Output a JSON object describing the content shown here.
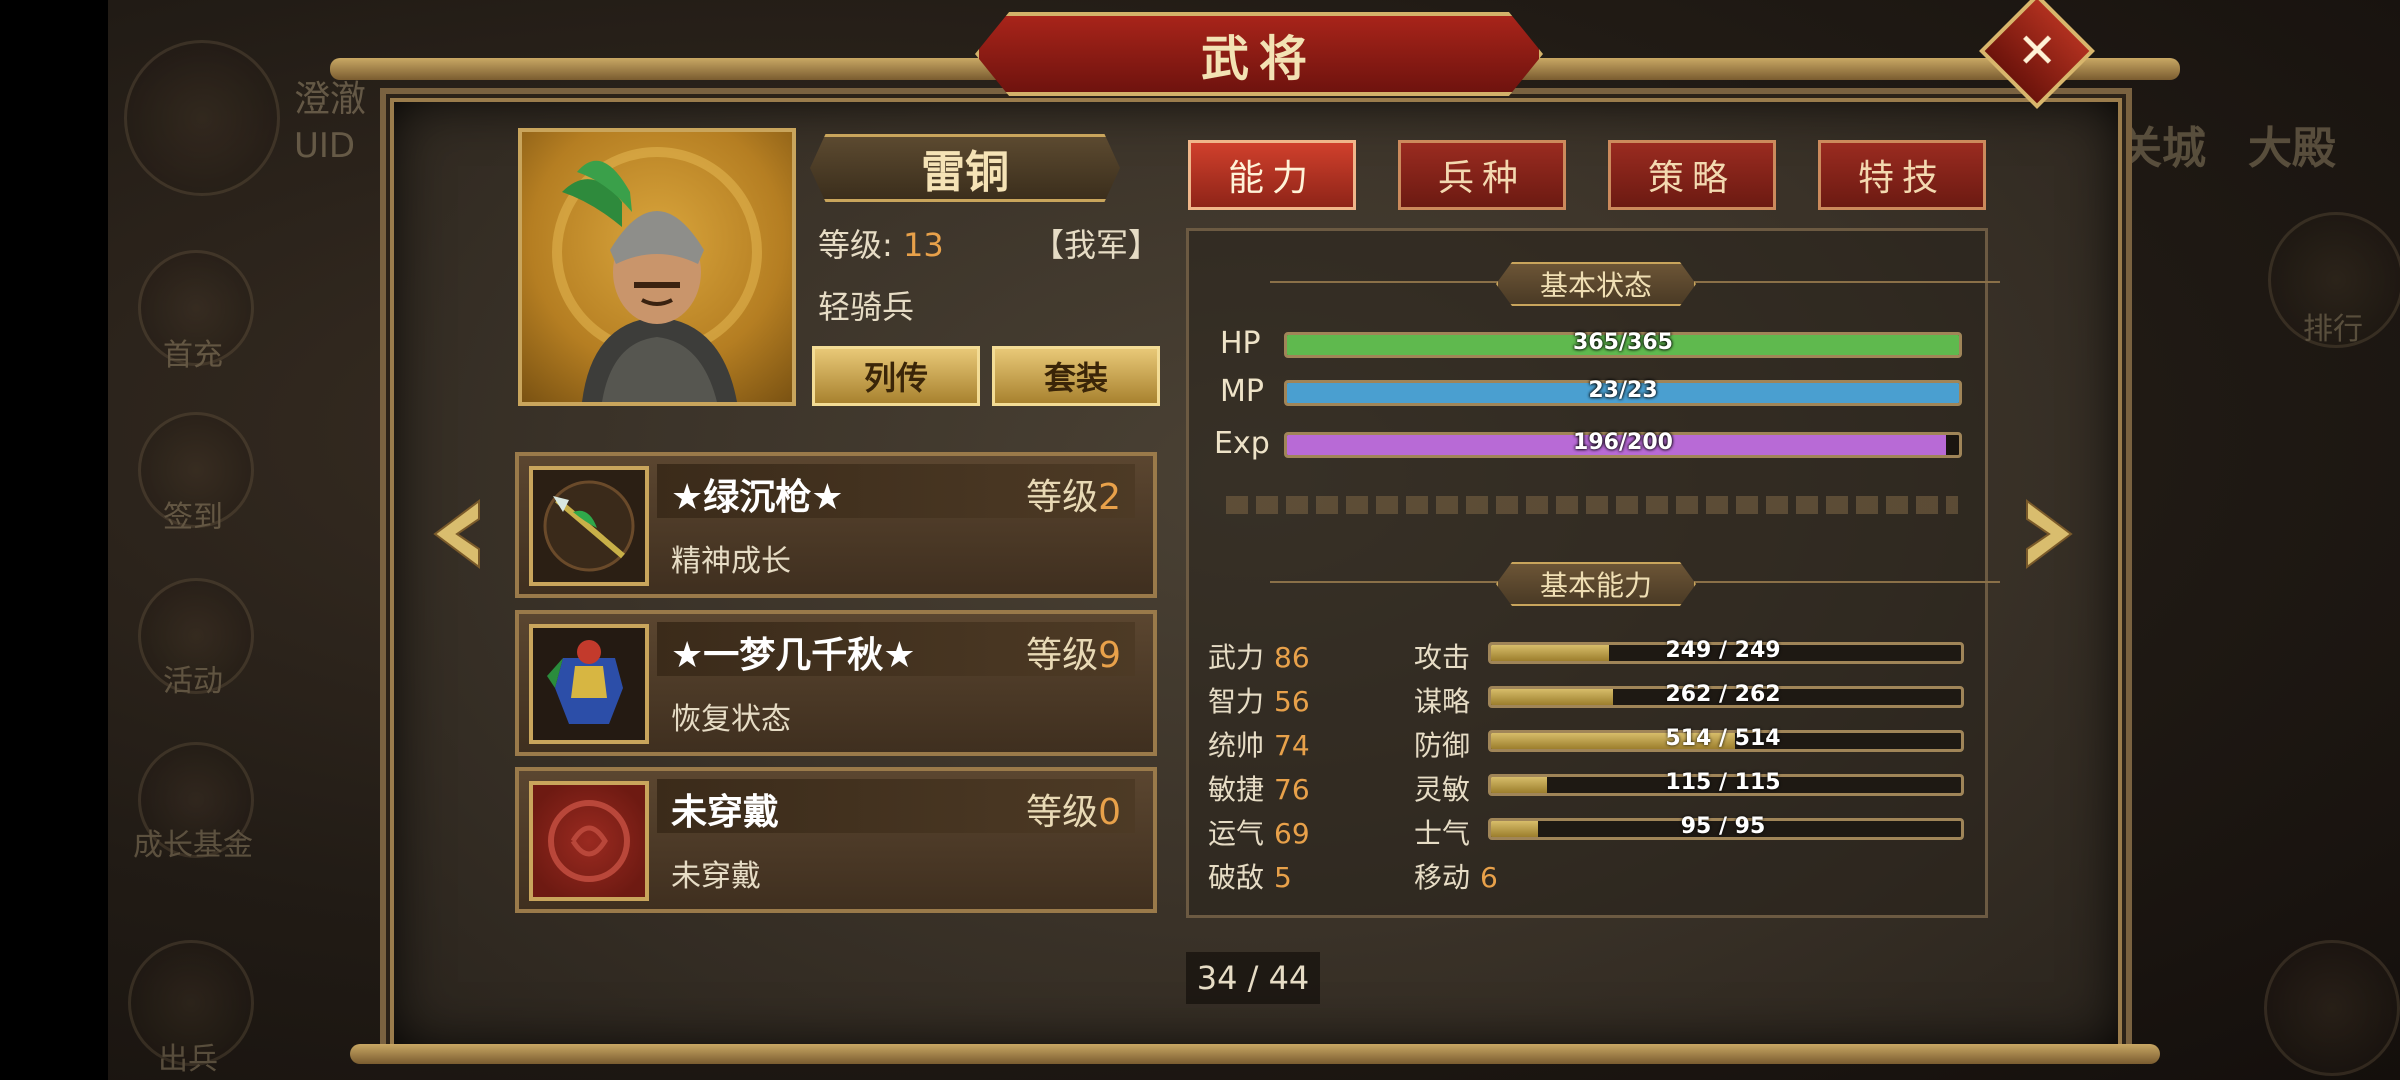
{
  "background": {
    "player_name": "澄澈",
    "uid_label": "UID",
    "left_menu": [
      "首充",
      "签到",
      "活动",
      "成长基金",
      "出兵"
    ],
    "right_tabs": [
      "关城",
      "大殿"
    ],
    "right_menu": [
      "排行"
    ]
  },
  "panel": {
    "title": "武将",
    "close_icon": "close-icon"
  },
  "general": {
    "name": "雷铜",
    "level_label": "等级:",
    "level_value": "13",
    "faction": "【我军】",
    "unit_type": "轻骑兵",
    "buttons": [
      "列传",
      "套装"
    ]
  },
  "tabs": [
    {
      "label": "能力",
      "active": true
    },
    {
      "label": "兵种",
      "active": false
    },
    {
      "label": "策略",
      "active": false
    },
    {
      "label": "特技",
      "active": false
    }
  ],
  "equipment": [
    {
      "name": "★绿沉枪★",
      "level_label": "等级",
      "level": "2",
      "desc": "精神成长",
      "icon": "spear-icon"
    },
    {
      "name": "★一梦几千秋★",
      "level_label": "等级",
      "level": "9",
      "desc": "恢复状态",
      "icon": "armor-icon"
    },
    {
      "name": "未穿戴",
      "level_label": "等级",
      "level": "0",
      "desc": "未穿戴",
      "icon": "empty-slot-icon"
    }
  ],
  "basic_status": {
    "title": "基本状态",
    "bars": [
      {
        "label": "HP",
        "text": "365/365",
        "fraction": 1.0,
        "color": "#5fb94e"
      },
      {
        "label": "MP",
        "text": "23/23",
        "fraction": 1.0,
        "color": "#4a9fd0"
      },
      {
        "label": "Exp",
        "text": "196/200",
        "fraction": 0.98,
        "color": "#b86ad6"
      }
    ]
  },
  "basic_ability": {
    "title": "基本能力",
    "attributes": [
      {
        "label": "武力",
        "value": "86"
      },
      {
        "label": "智力",
        "value": "56"
      },
      {
        "label": "统帅",
        "value": "74"
      },
      {
        "label": "敏捷",
        "value": "76"
      },
      {
        "label": "运气",
        "value": "69"
      },
      {
        "label": "破敌",
        "value": "5"
      }
    ],
    "combat": [
      {
        "label": "攻击",
        "text": "249 / 249",
        "fraction": 0.25
      },
      {
        "label": "谋略",
        "text": "262 / 262",
        "fraction": 0.26
      },
      {
        "label": "防御",
        "text": "514 / 514",
        "fraction": 0.52
      },
      {
        "label": "灵敏",
        "text": "115 / 115",
        "fraction": 0.12
      },
      {
        "label": "士气",
        "text": "95 / 95",
        "fraction": 0.1
      }
    ],
    "move_label": "移动",
    "move_value": "6"
  },
  "pager": {
    "text": "34 / 44"
  },
  "nav": {
    "prev_icon": "chevron-left-icon",
    "next_icon": "chevron-right-icon"
  }
}
